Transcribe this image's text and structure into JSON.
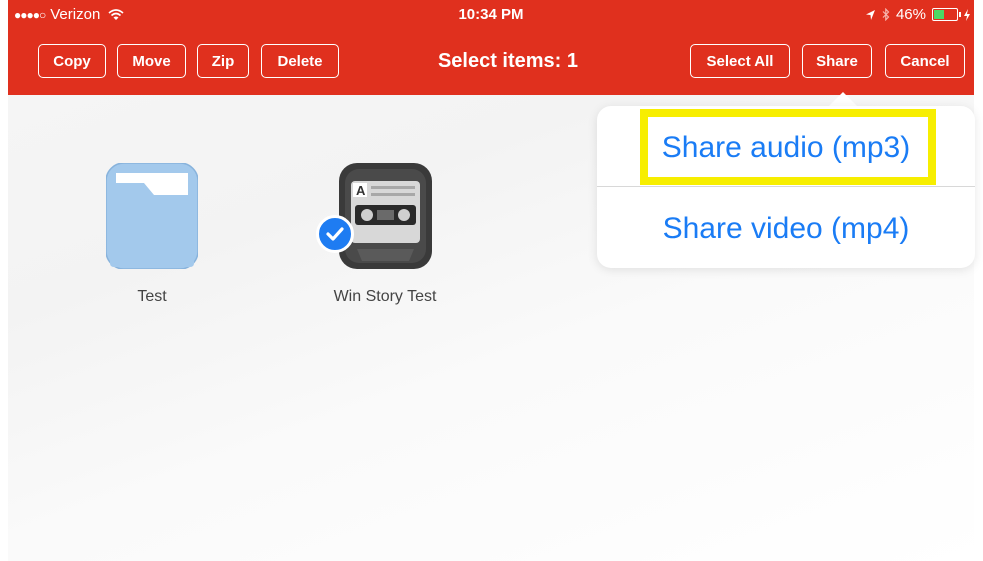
{
  "status": {
    "signal": "●●●●○",
    "carrier": "Verizon",
    "time": "10:34 PM",
    "battery_percent": "46%",
    "battery_level": 0.46
  },
  "toolbar": {
    "copy": "Copy",
    "move": "Move",
    "zip": "Zip",
    "delete": "Delete",
    "title": "Select items: 1",
    "select_all": "Select All",
    "share": "Share",
    "cancel": "Cancel"
  },
  "share_menu": {
    "items": [
      "Share audio (mp3)",
      "Share video (mp4)"
    ],
    "highlighted_index": 0
  },
  "files": [
    {
      "name": "Test",
      "icon": "folder-icon",
      "selected": false
    },
    {
      "name": "Win Story Test",
      "icon": "cassette-icon",
      "selected": true
    }
  ],
  "colors": {
    "accent": "#e0301e",
    "link": "#1a7cf5",
    "highlight": "#f7ee00",
    "checkmark": "#1e7cf2"
  }
}
